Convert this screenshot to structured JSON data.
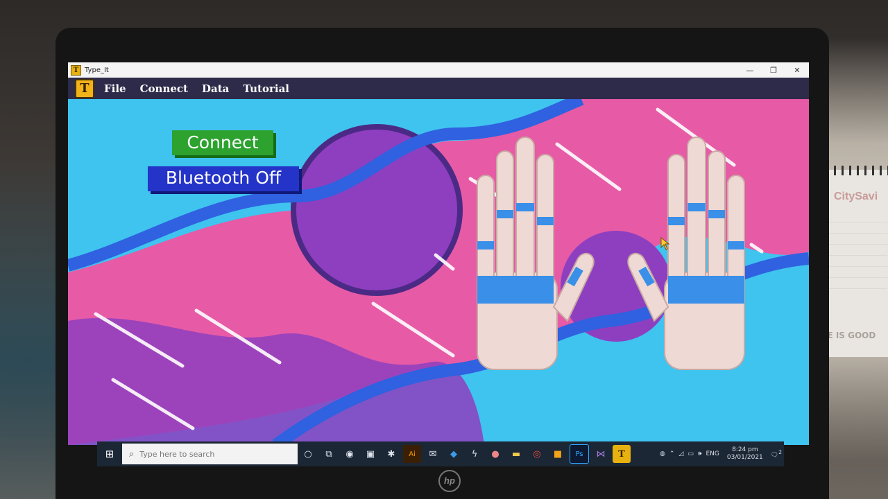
{
  "window": {
    "title": "Type_It",
    "controls": [
      "—",
      "❐",
      "✕"
    ]
  },
  "menu": {
    "logo": "T",
    "items": [
      "File",
      "Connect",
      "Data",
      "Tutorial"
    ]
  },
  "buttons": {
    "connect": "Connect",
    "bluetooth": "Bluetooth Off"
  },
  "taskbar": {
    "search_placeholder": "Type here to search",
    "language": "ENG",
    "time": "8:24 pm",
    "date": "03/01/2021",
    "notification_count": "2"
  },
  "calendar": {
    "brand": "CitySavi",
    "footer": "PLE IS GOOD"
  },
  "colors": {
    "sky": "#3fc3ef",
    "pink": "#e75aa6",
    "purple": "#8e3fbf",
    "wave_blue": "#2f61e0",
    "accent_band": "#3a8fe8",
    "connect_green": "#2da22f",
    "bluetooth_blue": "#2433c8",
    "menubar": "#2e2a4a"
  }
}
